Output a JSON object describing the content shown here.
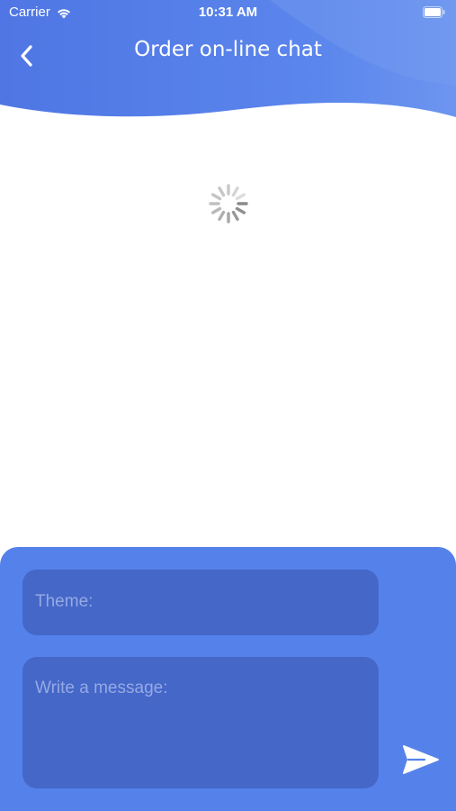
{
  "status_bar": {
    "carrier": "Carrier",
    "time": "10:31 AM"
  },
  "header": {
    "title": "Order on-line chat"
  },
  "composer": {
    "theme_placeholder": "Theme:",
    "message_placeholder": "Write a message:"
  },
  "icons": {
    "back": "chevron-left-icon",
    "send": "paper-plane-icon",
    "loading": "spinner-icon",
    "wifi": "wifi-icon",
    "battery": "battery-icon"
  },
  "colors": {
    "header_blue": "#4e74e3",
    "composer_blue": "#5582ea",
    "field_blue": "#4467c8",
    "placeholder": "#95a9e3"
  }
}
